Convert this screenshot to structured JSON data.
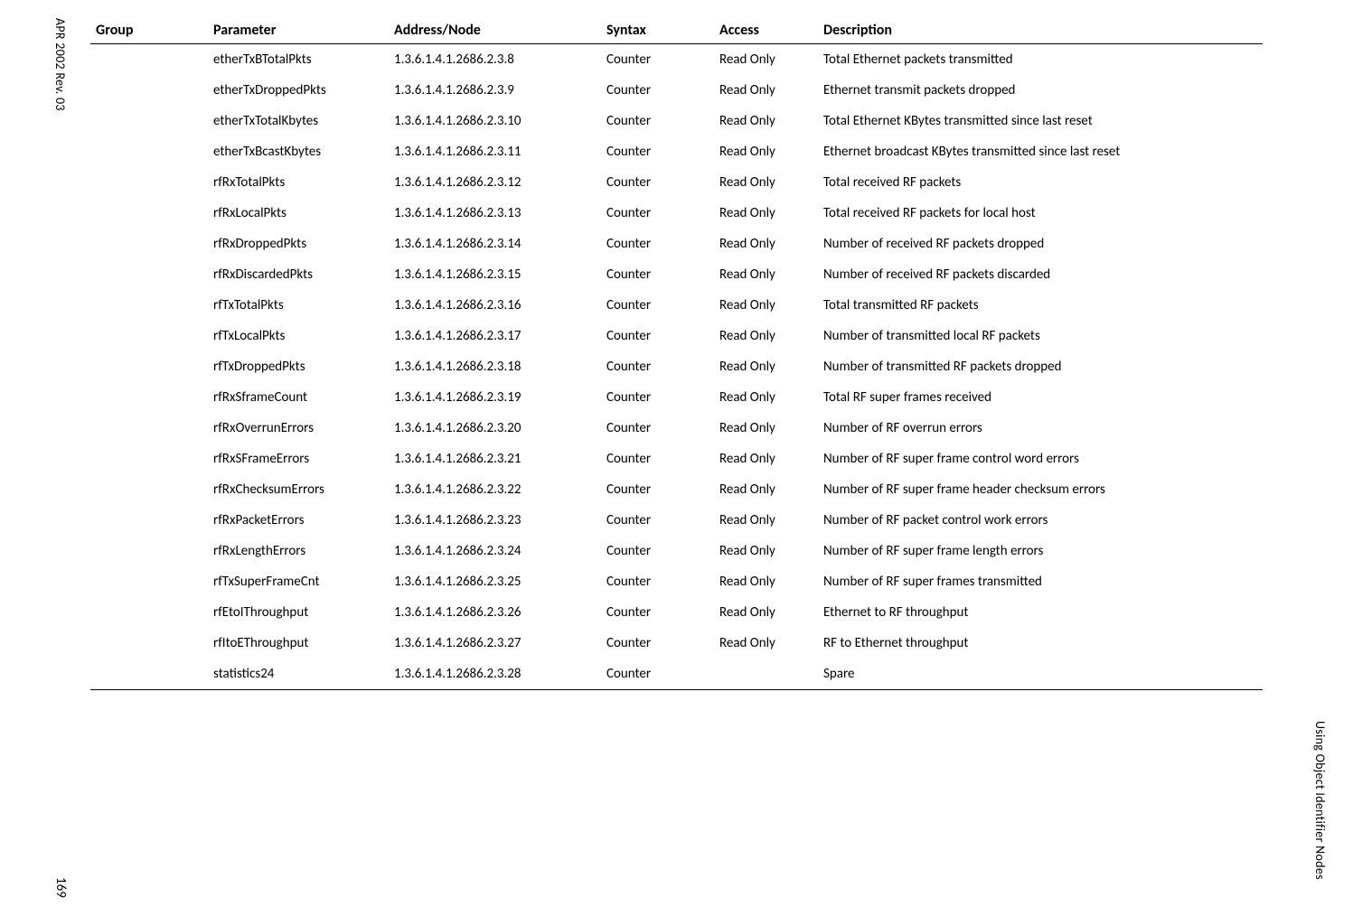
{
  "margin_left": "APR 2002 Rev. 03",
  "margin_right": "Using Object Identifier Nodes",
  "page_number": "169",
  "header": {
    "group": "Group",
    "parameter": "Parameter",
    "address": "Address/Node",
    "syntax": "Syntax",
    "access": "Access",
    "description": "Description"
  },
  "rows": [
    {
      "group": "",
      "param": "etherTxBTotalPkts",
      "addr": "1.3.6.1.4.1.2686.2.3.8",
      "syntax": "Counter",
      "access": "Read Only",
      "desc": "Total Ethernet packets transmitted"
    },
    {
      "group": "",
      "param": "etherTxDroppedPkts",
      "addr": "1.3.6.1.4.1.2686.2.3.9",
      "syntax": "Counter",
      "access": "Read Only",
      "desc": "Ethernet transmit packets dropped"
    },
    {
      "group": "",
      "param": "etherTxTotalKbytes",
      "addr": "1.3.6.1.4.1.2686.2.3.10",
      "syntax": "Counter",
      "access": "Read Only",
      "desc": "Total Ethernet KBytes transmitted since last reset"
    },
    {
      "group": "",
      "param": "etherTxBcastKbytes",
      "addr": "1.3.6.1.4.1.2686.2.3.11",
      "syntax": "Counter",
      "access": "Read Only",
      "desc": "Ethernet broadcast KBytes transmitted since last reset"
    },
    {
      "group": "",
      "param": "rfRxTotalPkts",
      "addr": "1.3.6.1.4.1.2686.2.3.12",
      "syntax": "Counter",
      "access": "Read Only",
      "desc": "Total received RF packets"
    },
    {
      "group": "",
      "param": "rfRxLocalPkts",
      "addr": "1.3.6.1.4.1.2686.2.3.13",
      "syntax": "Counter",
      "access": "Read Only",
      "desc": "Total received RF packets for local host"
    },
    {
      "group": "",
      "param": "rfRxDroppedPkts",
      "addr": "1.3.6.1.4.1.2686.2.3.14",
      "syntax": "Counter",
      "access": "Read Only",
      "desc": "Number of received RF packets dropped"
    },
    {
      "group": "",
      "param": "rfRxDiscardedPkts",
      "addr": "1.3.6.1.4.1.2686.2.3.15",
      "syntax": "Counter",
      "access": "Read Only",
      "desc": "Number of received RF packets discarded"
    },
    {
      "group": "",
      "param": "rfTxTotalPkts",
      "addr": "1.3.6.1.4.1.2686.2.3.16",
      "syntax": "Counter",
      "access": "Read Only",
      "desc": "Total transmitted RF packets"
    },
    {
      "group": "",
      "param": "rfTxLocalPkts",
      "addr": "1.3.6.1.4.1.2686.2.3.17",
      "syntax": "Counter",
      "access": "Read Only",
      "desc": "Number of transmitted local RF packets"
    },
    {
      "group": "",
      "param": "rfTxDroppedPkts",
      "addr": "1.3.6.1.4.1.2686.2.3.18",
      "syntax": "Counter",
      "access": "Read Only",
      "desc": "Number of transmitted RF packets dropped"
    },
    {
      "group": "",
      "param": "rfRxSframeCount",
      "addr": "1.3.6.1.4.1.2686.2.3.19",
      "syntax": "Counter",
      "access": "Read Only",
      "desc": "Total RF super frames received"
    },
    {
      "group": "",
      "param": "rfRxOverrunErrors",
      "addr": "1.3.6.1.4.1.2686.2.3.20",
      "syntax": "Counter",
      "access": "Read Only",
      "desc": "Number of RF overrun errors"
    },
    {
      "group": "",
      "param": "rfRxSFrameErrors",
      "addr": "1.3.6.1.4.1.2686.2.3.21",
      "syntax": "Counter",
      "access": "Read Only",
      "desc": "Number of RF super frame control word errors"
    },
    {
      "group": "",
      "param": "rfRxChecksumErrors",
      "addr": "1.3.6.1.4.1.2686.2.3.22",
      "syntax": "Counter",
      "access": "Read Only",
      "desc": "Number of RF super frame header checksum errors"
    },
    {
      "group": "",
      "param": "rfRxPacketErrors",
      "addr": "1.3.6.1.4.1.2686.2.3.23",
      "syntax": "Counter",
      "access": "Read Only",
      "desc": "Number of RF packet control work errors"
    },
    {
      "group": "",
      "param": "rfRxLengthErrors",
      "addr": "1.3.6.1.4.1.2686.2.3.24",
      "syntax": "Counter",
      "access": "Read Only",
      "desc": "Number of RF super frame length errors"
    },
    {
      "group": "",
      "param": "rfTxSuperFrameCnt",
      "addr": "1.3.6.1.4.1.2686.2.3.25",
      "syntax": "Counter",
      "access": "Read Only",
      "desc": "Number of RF super frames transmitted"
    },
    {
      "group": "",
      "param": "rfEtoIThroughput",
      "addr": "1.3.6.1.4.1.2686.2.3.26",
      "syntax": "Counter",
      "access": "Read Only",
      "desc": "Ethernet to RF throughput"
    },
    {
      "group": "",
      "param": "rfItoEThroughput",
      "addr": "1.3.6.1.4.1.2686.2.3.27",
      "syntax": "Counter",
      "access": "Read Only",
      "desc": "RF to Ethernet throughput"
    },
    {
      "group": "",
      "param": "statistics24",
      "addr": "1.3.6.1.4.1.2686.2.3.28",
      "syntax": "Counter",
      "access": "",
      "desc": "Spare"
    }
  ]
}
